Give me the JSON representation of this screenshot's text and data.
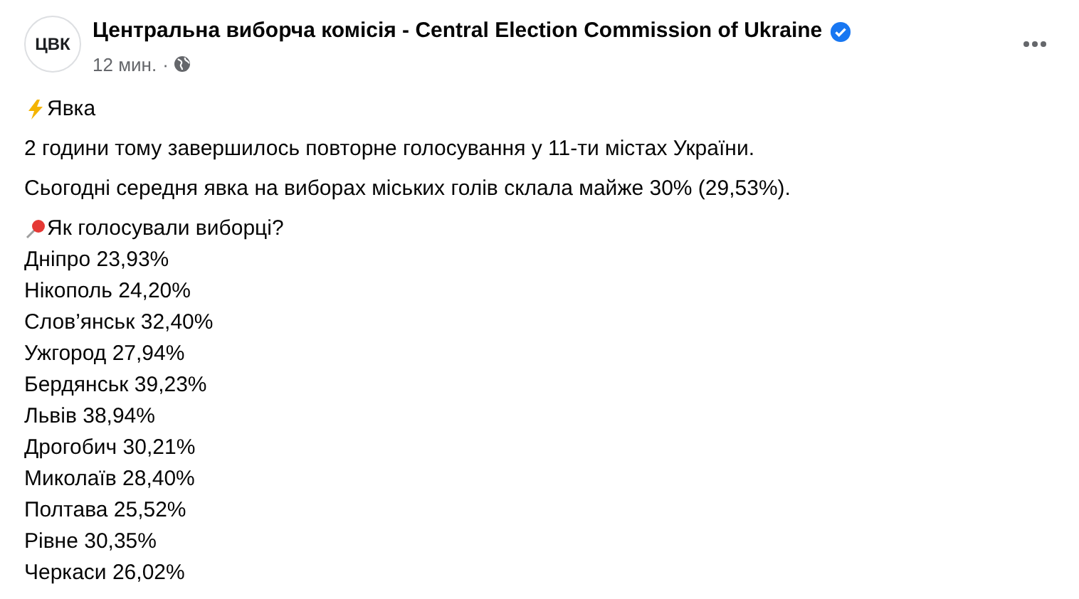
{
  "post": {
    "avatar_text": "ЦВК",
    "author": "Центральна виборча комісія - Central Election Commission of Ukraine",
    "verified": true,
    "time": "12 мин.",
    "separator": "·",
    "title": "Явка",
    "paragraphs": [
      "2 години тому завершилось повторне голосування у 11-ти містах України.",
      "Сьогодні середня явка на виборах міських голів склала майже 30% (29,53%)."
    ],
    "list_heading": "Як голосували виборці?",
    "lines": [
      "Дніпро 23,93%",
      "Нікополь 24,20%",
      "Слов’янськ 32,40%",
      "Ужгород 27,94%",
      "Бердянськ 39,23%",
      "Львів 38,94%",
      "Дрогобич 30,21%",
      "Миколаїв 28,40%",
      "Полтава 25,52%",
      "Рівне 30,35%",
      "Черкаси 26,02%"
    ]
  }
}
